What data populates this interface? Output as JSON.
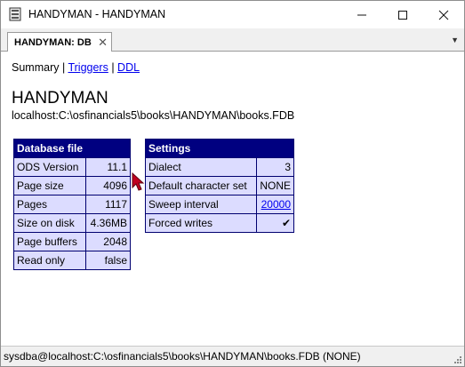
{
  "window": {
    "title": "HANDYMAN - HANDYMAN",
    "minimize_symbol": "—",
    "maximize_symbol": "☐",
    "close_symbol": "✕"
  },
  "tab": {
    "label": "HANDYMAN: DB",
    "close_symbol": "✕",
    "menu_symbol": "▼"
  },
  "nav": {
    "summary": "Summary",
    "sep1": " | ",
    "triggers": "Triggers",
    "sep2": " | ",
    "ddl": "DDL"
  },
  "database": {
    "name": "HANDYMAN",
    "path": "localhost:C:\\osfinancials5\\books\\HANDYMAN\\books.FDB"
  },
  "database_file": {
    "header": "Database file",
    "rows": [
      {
        "key": "ODS Version",
        "value": "11.1"
      },
      {
        "key": "Page size",
        "value": "4096"
      },
      {
        "key": "Pages",
        "value": "1117"
      },
      {
        "key": "Size on disk",
        "value": "4.36MB"
      },
      {
        "key": "Page buffers",
        "value": "2048"
      },
      {
        "key": "Read only",
        "value": "false"
      }
    ]
  },
  "settings": {
    "header": "Settings",
    "rows": [
      {
        "key": "Dialect",
        "value": "3"
      },
      {
        "key": "Default character set",
        "value": "NONE"
      },
      {
        "key": "Sweep interval",
        "value": "20000"
      },
      {
        "key": "Forced writes",
        "value": "✔"
      }
    ]
  },
  "status": {
    "text": "sysdba@localhost:C:\\osfinancials5\\books\\HANDYMAN\\books.FDB (NONE)"
  },
  "colors": {
    "header_bg": "#000080",
    "cell_bg": "#dcdcff",
    "link": "#0000ee",
    "cursor": "#c00020"
  },
  "icons": [
    "app-icon",
    "minimize-icon",
    "maximize-icon",
    "close-icon",
    "tab-close-icon",
    "tab-menu-icon",
    "checkmark-icon",
    "mouse-cursor-icon",
    "resize-grip-icon"
  ]
}
